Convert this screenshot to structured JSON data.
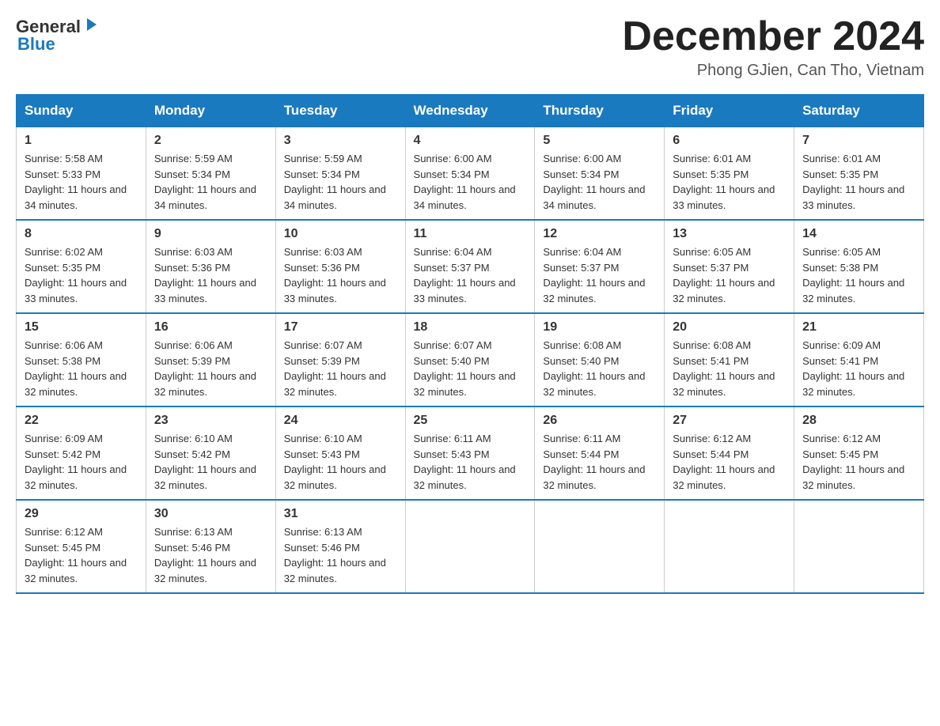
{
  "logo": {
    "general": "General",
    "blue": "Blue"
  },
  "title": {
    "month_year": "December 2024",
    "location": "Phong GJien, Can Tho, Vietnam"
  },
  "days_of_week": [
    "Sunday",
    "Monday",
    "Tuesday",
    "Wednesday",
    "Thursday",
    "Friday",
    "Saturday"
  ],
  "weeks": [
    [
      {
        "num": "1",
        "sunrise": "Sunrise: 5:58 AM",
        "sunset": "Sunset: 5:33 PM",
        "daylight": "Daylight: 11 hours and 34 minutes."
      },
      {
        "num": "2",
        "sunrise": "Sunrise: 5:59 AM",
        "sunset": "Sunset: 5:34 PM",
        "daylight": "Daylight: 11 hours and 34 minutes."
      },
      {
        "num": "3",
        "sunrise": "Sunrise: 5:59 AM",
        "sunset": "Sunset: 5:34 PM",
        "daylight": "Daylight: 11 hours and 34 minutes."
      },
      {
        "num": "4",
        "sunrise": "Sunrise: 6:00 AM",
        "sunset": "Sunset: 5:34 PM",
        "daylight": "Daylight: 11 hours and 34 minutes."
      },
      {
        "num": "5",
        "sunrise": "Sunrise: 6:00 AM",
        "sunset": "Sunset: 5:34 PM",
        "daylight": "Daylight: 11 hours and 34 minutes."
      },
      {
        "num": "6",
        "sunrise": "Sunrise: 6:01 AM",
        "sunset": "Sunset: 5:35 PM",
        "daylight": "Daylight: 11 hours and 33 minutes."
      },
      {
        "num": "7",
        "sunrise": "Sunrise: 6:01 AM",
        "sunset": "Sunset: 5:35 PM",
        "daylight": "Daylight: 11 hours and 33 minutes."
      }
    ],
    [
      {
        "num": "8",
        "sunrise": "Sunrise: 6:02 AM",
        "sunset": "Sunset: 5:35 PM",
        "daylight": "Daylight: 11 hours and 33 minutes."
      },
      {
        "num": "9",
        "sunrise": "Sunrise: 6:03 AM",
        "sunset": "Sunset: 5:36 PM",
        "daylight": "Daylight: 11 hours and 33 minutes."
      },
      {
        "num": "10",
        "sunrise": "Sunrise: 6:03 AM",
        "sunset": "Sunset: 5:36 PM",
        "daylight": "Daylight: 11 hours and 33 minutes."
      },
      {
        "num": "11",
        "sunrise": "Sunrise: 6:04 AM",
        "sunset": "Sunset: 5:37 PM",
        "daylight": "Daylight: 11 hours and 33 minutes."
      },
      {
        "num": "12",
        "sunrise": "Sunrise: 6:04 AM",
        "sunset": "Sunset: 5:37 PM",
        "daylight": "Daylight: 11 hours and 32 minutes."
      },
      {
        "num": "13",
        "sunrise": "Sunrise: 6:05 AM",
        "sunset": "Sunset: 5:37 PM",
        "daylight": "Daylight: 11 hours and 32 minutes."
      },
      {
        "num": "14",
        "sunrise": "Sunrise: 6:05 AM",
        "sunset": "Sunset: 5:38 PM",
        "daylight": "Daylight: 11 hours and 32 minutes."
      }
    ],
    [
      {
        "num": "15",
        "sunrise": "Sunrise: 6:06 AM",
        "sunset": "Sunset: 5:38 PM",
        "daylight": "Daylight: 11 hours and 32 minutes."
      },
      {
        "num": "16",
        "sunrise": "Sunrise: 6:06 AM",
        "sunset": "Sunset: 5:39 PM",
        "daylight": "Daylight: 11 hours and 32 minutes."
      },
      {
        "num": "17",
        "sunrise": "Sunrise: 6:07 AM",
        "sunset": "Sunset: 5:39 PM",
        "daylight": "Daylight: 11 hours and 32 minutes."
      },
      {
        "num": "18",
        "sunrise": "Sunrise: 6:07 AM",
        "sunset": "Sunset: 5:40 PM",
        "daylight": "Daylight: 11 hours and 32 minutes."
      },
      {
        "num": "19",
        "sunrise": "Sunrise: 6:08 AM",
        "sunset": "Sunset: 5:40 PM",
        "daylight": "Daylight: 11 hours and 32 minutes."
      },
      {
        "num": "20",
        "sunrise": "Sunrise: 6:08 AM",
        "sunset": "Sunset: 5:41 PM",
        "daylight": "Daylight: 11 hours and 32 minutes."
      },
      {
        "num": "21",
        "sunrise": "Sunrise: 6:09 AM",
        "sunset": "Sunset: 5:41 PM",
        "daylight": "Daylight: 11 hours and 32 minutes."
      }
    ],
    [
      {
        "num": "22",
        "sunrise": "Sunrise: 6:09 AM",
        "sunset": "Sunset: 5:42 PM",
        "daylight": "Daylight: 11 hours and 32 minutes."
      },
      {
        "num": "23",
        "sunrise": "Sunrise: 6:10 AM",
        "sunset": "Sunset: 5:42 PM",
        "daylight": "Daylight: 11 hours and 32 minutes."
      },
      {
        "num": "24",
        "sunrise": "Sunrise: 6:10 AM",
        "sunset": "Sunset: 5:43 PM",
        "daylight": "Daylight: 11 hours and 32 minutes."
      },
      {
        "num": "25",
        "sunrise": "Sunrise: 6:11 AM",
        "sunset": "Sunset: 5:43 PM",
        "daylight": "Daylight: 11 hours and 32 minutes."
      },
      {
        "num": "26",
        "sunrise": "Sunrise: 6:11 AM",
        "sunset": "Sunset: 5:44 PM",
        "daylight": "Daylight: 11 hours and 32 minutes."
      },
      {
        "num": "27",
        "sunrise": "Sunrise: 6:12 AM",
        "sunset": "Sunset: 5:44 PM",
        "daylight": "Daylight: 11 hours and 32 minutes."
      },
      {
        "num": "28",
        "sunrise": "Sunrise: 6:12 AM",
        "sunset": "Sunset: 5:45 PM",
        "daylight": "Daylight: 11 hours and 32 minutes."
      }
    ],
    [
      {
        "num": "29",
        "sunrise": "Sunrise: 6:12 AM",
        "sunset": "Sunset: 5:45 PM",
        "daylight": "Daylight: 11 hours and 32 minutes."
      },
      {
        "num": "30",
        "sunrise": "Sunrise: 6:13 AM",
        "sunset": "Sunset: 5:46 PM",
        "daylight": "Daylight: 11 hours and 32 minutes."
      },
      {
        "num": "31",
        "sunrise": "Sunrise: 6:13 AM",
        "sunset": "Sunset: 5:46 PM",
        "daylight": "Daylight: 11 hours and 32 minutes."
      },
      {
        "num": "",
        "sunrise": "",
        "sunset": "",
        "daylight": ""
      },
      {
        "num": "",
        "sunrise": "",
        "sunset": "",
        "daylight": ""
      },
      {
        "num": "",
        "sunrise": "",
        "sunset": "",
        "daylight": ""
      },
      {
        "num": "",
        "sunrise": "",
        "sunset": "",
        "daylight": ""
      }
    ]
  ]
}
